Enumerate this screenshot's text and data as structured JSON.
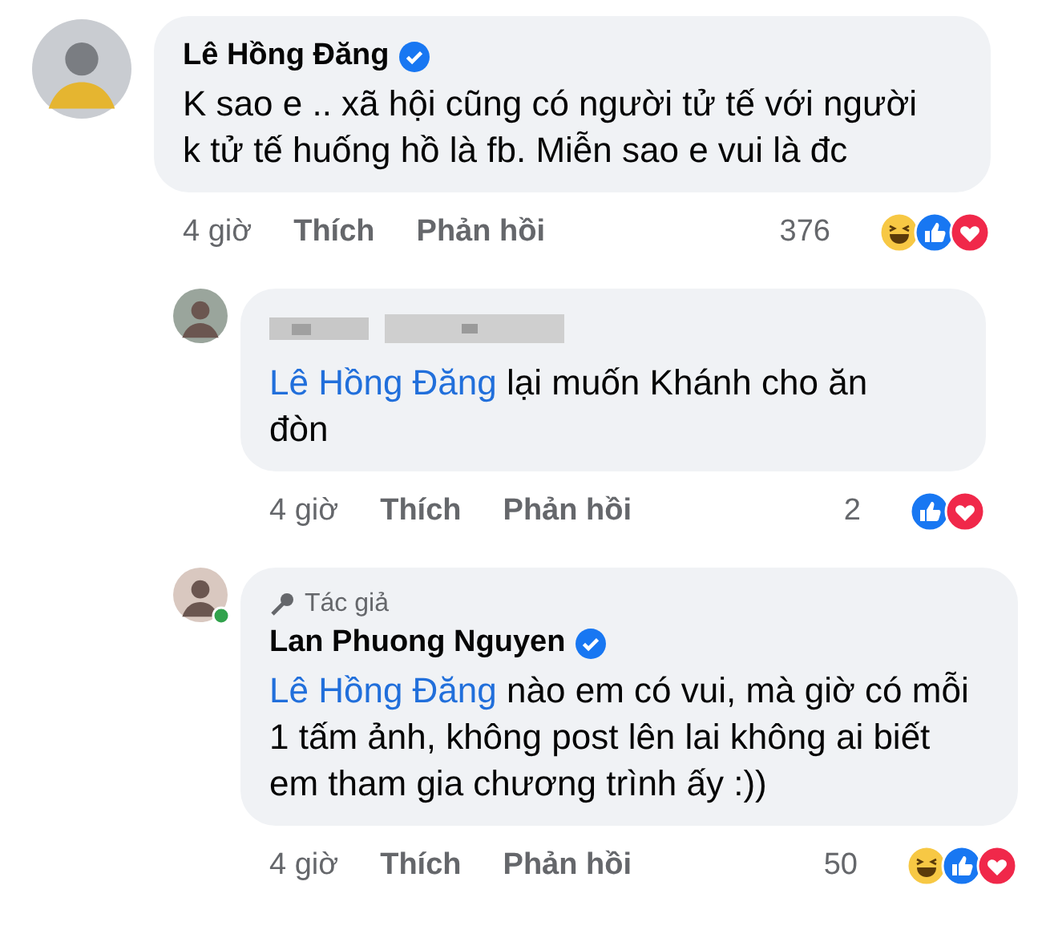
{
  "comments": [
    {
      "author": "Lê Hồng Đăng",
      "verified": true,
      "text": "K sao e .. xã hội cũng có người tử tế với người k tử tế huống hồ là fb. Miễn sao e vui là đc",
      "time": "4 giờ",
      "actions": [
        "Thích",
        "Phản hồi"
      ],
      "reaction_count": "376",
      "reactions": [
        {
          "kind": "haha"
        },
        {
          "kind": "like"
        },
        {
          "kind": "love"
        }
      ],
      "replies": [
        {
          "author_hidden": true,
          "mention": "Lê Hồng Đăng",
          "text": "lại muốn Khánh cho ăn đòn",
          "time": "4 giờ",
          "actions": [
            "Thích",
            "Phản hồi"
          ],
          "reaction_count": "2",
          "reactions": [
            {
              "kind": "like"
            },
            {
              "kind": "love"
            }
          ]
        },
        {
          "badge": "Tác giả",
          "author": "Lan Phuong Nguyen",
          "verified": true,
          "online": true,
          "mention": "Lê Hồng Đăng",
          "text": "nào em có vui, mà giờ có mỗi 1 tấm ảnh, không post lên lai không ai biết em tham gia chương trình ấy :))",
          "time": "4 giờ",
          "actions": [
            "Thích",
            "Phản hồi"
          ],
          "reaction_count": "50",
          "reactions": [
            {
              "kind": "haha"
            },
            {
              "kind": "like"
            },
            {
              "kind": "love"
            }
          ]
        }
      ]
    }
  ]
}
